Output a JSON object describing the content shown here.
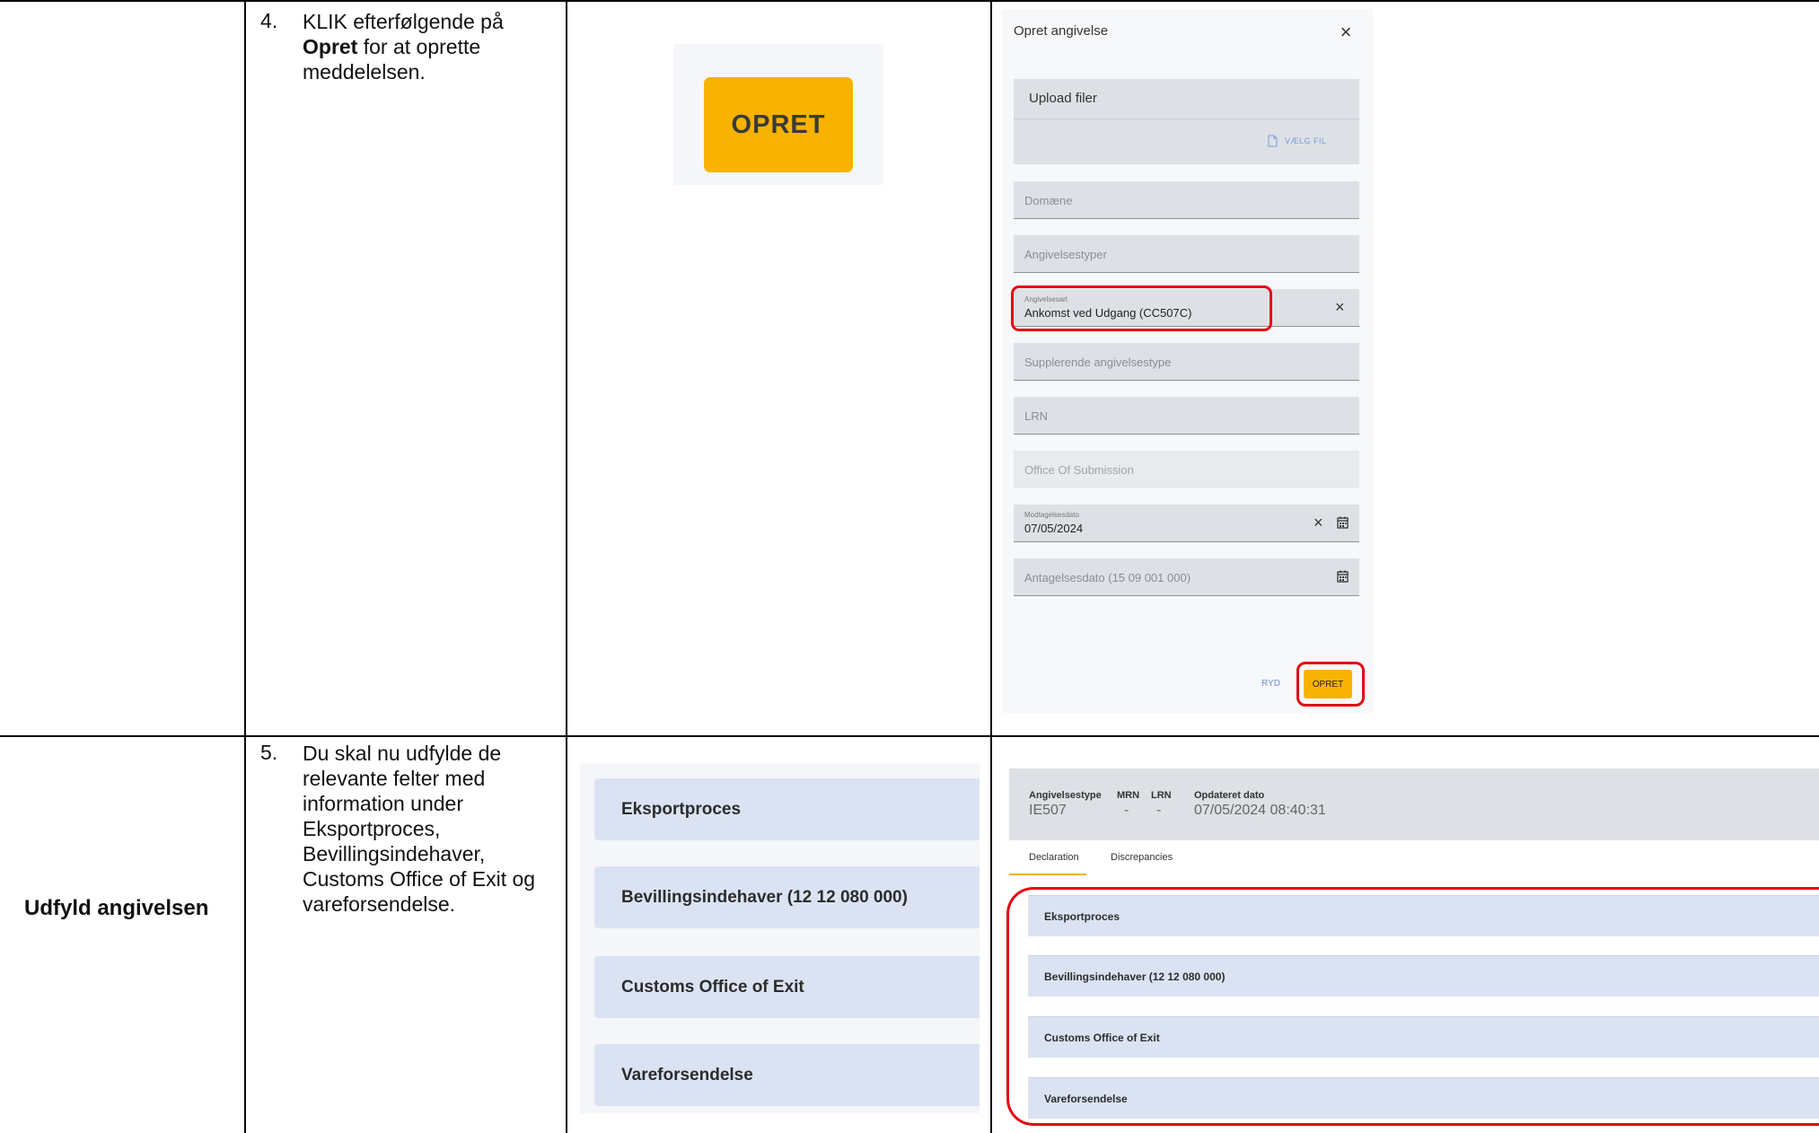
{
  "row4": {
    "step_number": "4.",
    "text_part1": "KLIK efterfølgende på",
    "text_bold": "Opret",
    "text_part2": "for at oprette",
    "text_part3": "meddelelsen.",
    "big_button_label": "OPRET",
    "dialog": {
      "title": "Opret angivelse",
      "upload_label": "Upload filer",
      "choose_file_label": "VÆLG FIL",
      "domain_placeholder": "Domæne",
      "types_placeholder": "Angivelsestyper",
      "art_label": "Angivelsesart",
      "art_value": "Ankomst ved Udgang (CC507C)",
      "supplementary_placeholder": "Supplerende angivelsestype",
      "lrn_placeholder": "LRN",
      "office_placeholder": "Office Of Submission",
      "receipt_label": "Modtagelsesdato",
      "receipt_value": "07/05/2024",
      "acceptance_placeholder": "Antagelsesdato (15 09 001 000)",
      "clear_label": "RYD",
      "create_label": "OPRET"
    }
  },
  "row5": {
    "section_title": "Udfyld angivelsen",
    "step_number": "5.",
    "text_lines": [
      "Du skal nu udfylde de",
      "relevante felter med",
      "information under",
      "Eksportproces,",
      "Bevillingsindehaver,",
      "Customs Office of Exit og",
      "vareforsendelse."
    ],
    "sections": [
      "Eksportproces",
      "Bevillingsindehaver (12 12 080 000)",
      "Customs Office of Exit",
      "Vareforsendelse"
    ],
    "header": {
      "type_label": "Angivelsestype",
      "type_value": "IE507",
      "mrn_label": "MRN",
      "mrn_value": "-",
      "lrn_label": "LRN",
      "lrn_value": "-",
      "updated_label": "Opdateret dato",
      "updated_value": "07/05/2024 08:40:31"
    },
    "tabs": [
      "Declaration",
      "Discrepancies"
    ]
  },
  "colors": {
    "accent": "#f8b200",
    "highlight": "#e30613",
    "section_bg": "#dbe3f3"
  }
}
